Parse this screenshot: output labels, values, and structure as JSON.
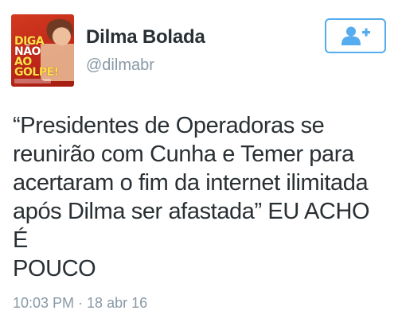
{
  "user": {
    "display_name": "Dilma Bolada",
    "username": "@dilmabr",
    "avatar": {
      "line1": "DIGA",
      "line2": "NÃO",
      "line3": "AO",
      "line4": "GOLPE!"
    }
  },
  "follow_button": {
    "icon": "add-user-icon",
    "color": "#55acee"
  },
  "tweet": {
    "text": "“Presidentes de Operadoras se\nreunirão com Cunha e Temer para\nacertaram o fim da internet ilimitada\napós Dilma ser afastada” EU ACHO É\nPOUCO",
    "timestamp": "10:03 PM · 18 abr 16"
  }
}
